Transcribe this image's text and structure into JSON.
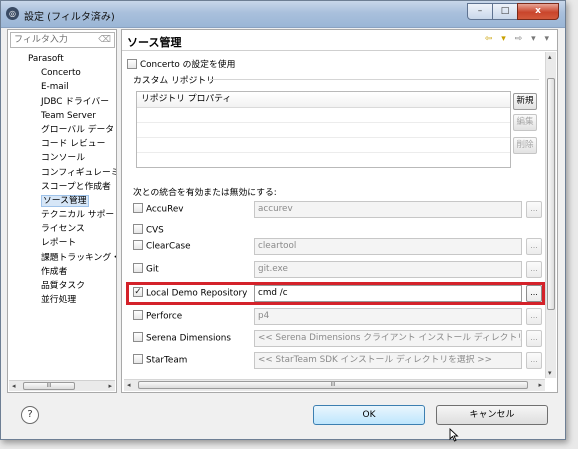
{
  "window": {
    "title": "設定 (フィルタ済み)",
    "controls": {
      "minimize": "–",
      "maximize": "□",
      "close": "x"
    }
  },
  "sidebar": {
    "filter_placeholder": "フィルタ入力",
    "root": "Parasoft",
    "items": [
      {
        "label": "Concerto"
      },
      {
        "label": "E-mail"
      },
      {
        "label": "JDBC ドライバー"
      },
      {
        "label": "Team Server"
      },
      {
        "label": "グローバル データ"
      },
      {
        "label": "コード レビュー"
      },
      {
        "label": "コンソール"
      },
      {
        "label": "コンフィギュレーミ"
      },
      {
        "label": "スコープと作成者"
      },
      {
        "label": "ソース管理",
        "selected": true
      },
      {
        "label": "テクニカル サポー"
      },
      {
        "label": "ライセンス"
      },
      {
        "label": "レポート"
      },
      {
        "label": "課題トラッキング・"
      },
      {
        "label": "作成者"
      },
      {
        "label": "品質タスク"
      },
      {
        "label": "並行処理"
      }
    ],
    "scroll_arrow_left": "◂",
    "scroll_arrow_right": "▸",
    "scroll_grip": "III"
  },
  "main": {
    "title": "ソース管理",
    "nav": {
      "back": "⇦ ▾",
      "forward": "⇨ ▾",
      "menu": "▾"
    },
    "concerto_checkbox": {
      "label": "Concerto の設定を使用",
      "checked": false
    },
    "custom_repo_label": "カスタム リポジトリ",
    "repo_table_header": "リポジトリ プロパティ",
    "repo_buttons": {
      "new": "新規",
      "edit": "編集",
      "delete": "削除"
    },
    "integration_label": "次との統合を有効または無効にする:",
    "integrations": [
      {
        "name": "AccuRev",
        "checked": false,
        "value": "accurev",
        "browse": "..."
      },
      {
        "name": "CVS",
        "checked": false,
        "value": "",
        "browse": ""
      },
      {
        "name": "ClearCase",
        "checked": false,
        "value": "cleartool",
        "browse": "..."
      },
      {
        "name": "Git",
        "checked": false,
        "value": "git.exe",
        "browse": "..."
      },
      {
        "name": "Local Demo Repository",
        "checked": true,
        "value": "cmd /c",
        "browse": "..."
      },
      {
        "name": "Perforce",
        "checked": false,
        "value": "p4",
        "browse": "..."
      },
      {
        "name": "Serena Dimensions",
        "checked": false,
        "value": "<< Serena Dimensions クライアント インストール ディレクトリ >>",
        "browse": "..."
      },
      {
        "name": "StarTeam",
        "checked": false,
        "value": "<< StarTeam SDK インストール ディレクトリを選択 >>",
        "browse": "..."
      }
    ],
    "check_mark": "✓",
    "scroll_grip": "III",
    "scroll_up": "▴",
    "scroll_down": "▾",
    "scroll_left": "◂",
    "scroll_right": "▸"
  },
  "footer": {
    "help": "?",
    "ok": "OK",
    "cancel": "キャンセル"
  },
  "colors": {
    "highlight": "#d4222a",
    "ok_button": "#bee6fd",
    "selection": "#d6e6f7"
  }
}
